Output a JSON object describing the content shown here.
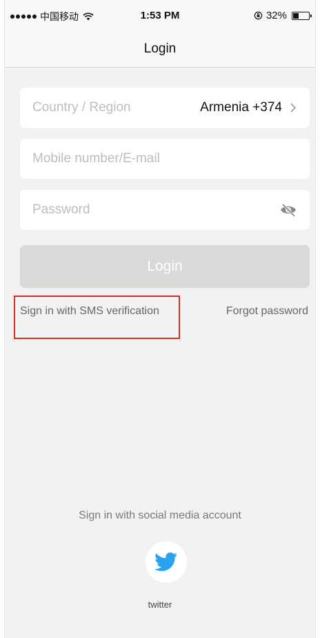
{
  "status_bar": {
    "carrier": "中国移动",
    "time": "1:53 PM",
    "battery_text": "32%",
    "battery_level": 0.32
  },
  "nav": {
    "title": "Login"
  },
  "form": {
    "country_label": "Country / Region",
    "country_value": "Armenia +374",
    "mobile_placeholder": "Mobile number/E-mail",
    "password_placeholder": "Password",
    "login_label": "Login"
  },
  "links": {
    "sms": "Sign in with SMS verification",
    "forgot": "Forgot password"
  },
  "social": {
    "title": "Sign in with social media account",
    "twitter_label": "twitter"
  },
  "colors": {
    "background": "#f2f2f2",
    "highlight": "#e0291d",
    "twitter_blue": "#2aa3ef",
    "disabled_button": "#d9d9d9"
  },
  "icons": [
    "wifi-icon",
    "lock-rotation-icon",
    "battery-icon",
    "chevron-right-icon",
    "eye-off-icon",
    "twitter-bird-icon"
  ]
}
